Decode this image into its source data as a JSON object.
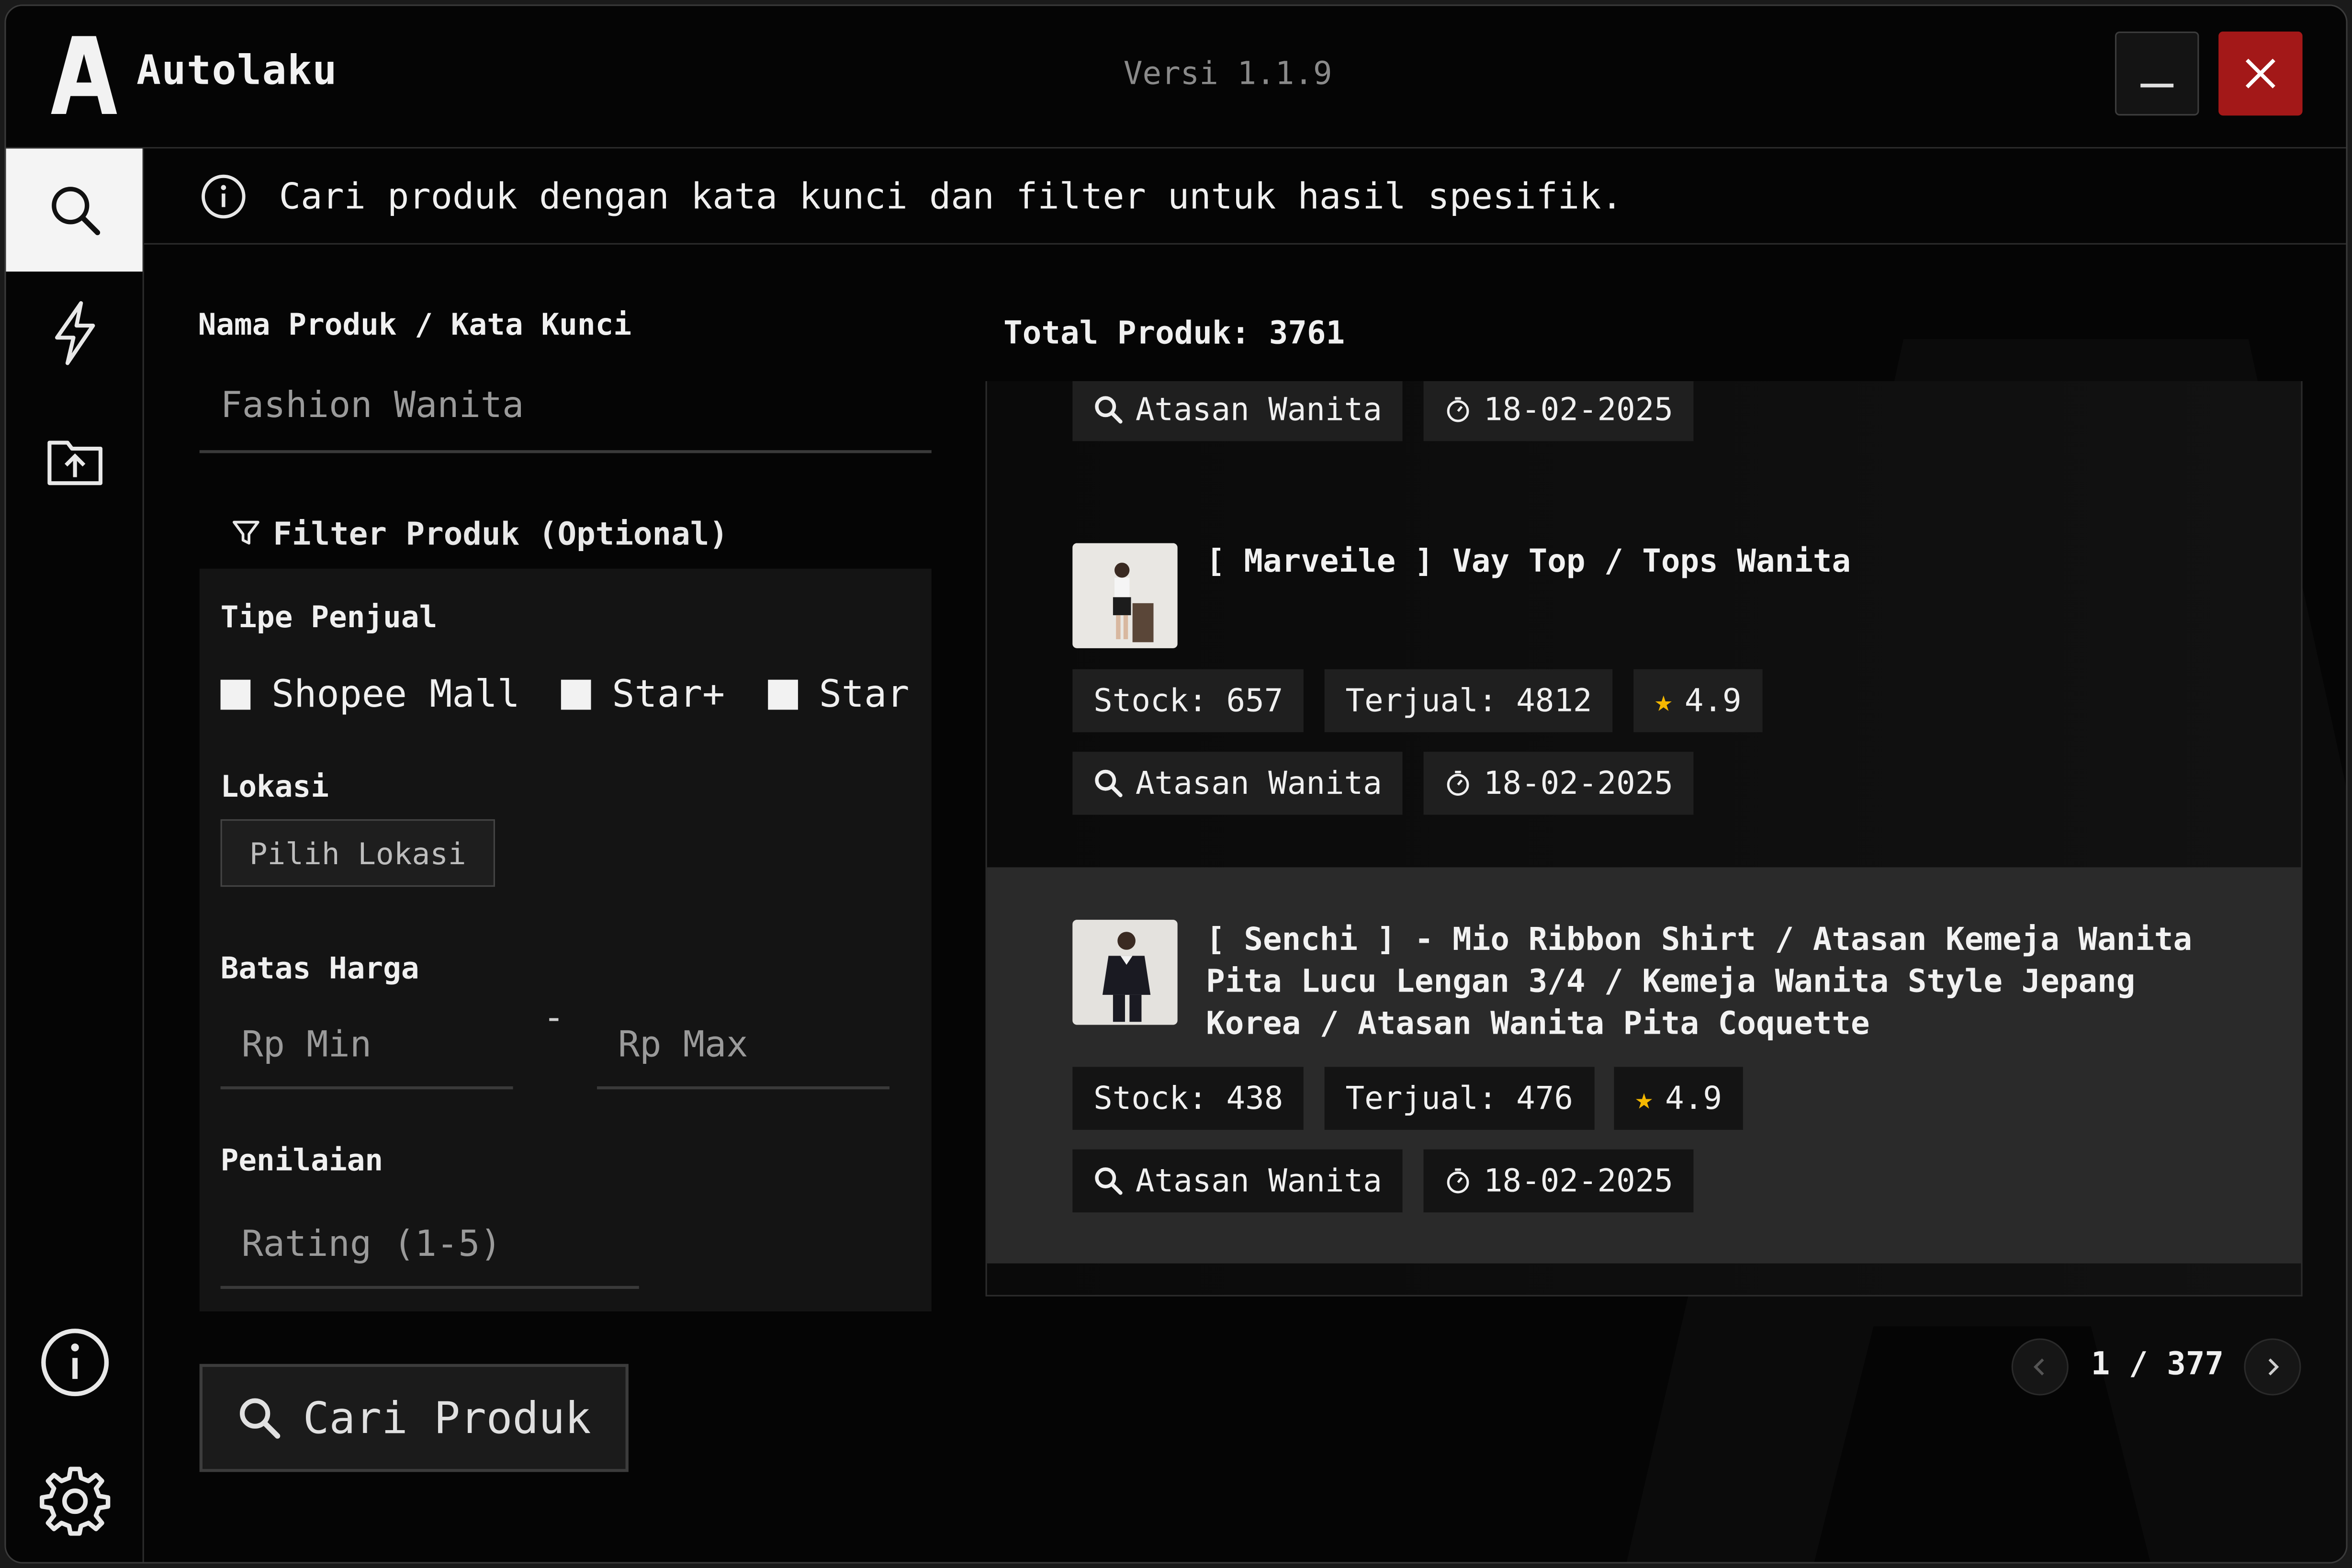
{
  "app": {
    "title": "Autolaku",
    "version": "Versi 1.1.9",
    "accent_close": "#a31818"
  },
  "sidebar": {
    "items": [
      {
        "icon": "search-icon",
        "active": true
      },
      {
        "icon": "lightning-icon",
        "active": false
      },
      {
        "icon": "folder-upload-icon",
        "active": false
      },
      {
        "icon": "info-icon",
        "active": false
      },
      {
        "icon": "gear-icon",
        "active": false
      }
    ]
  },
  "info_bar": {
    "text": "Cari produk dengan kata kunci dan filter untuk hasil spesifik."
  },
  "search": {
    "label": "Nama Produk / Kata Kunci",
    "value": "Fashion Wanita"
  },
  "filter": {
    "heading": "Filter Produk (Optional)",
    "seller_type_label": "Tipe Penjual",
    "seller_types": [
      "Shopee Mall",
      "Star+",
      "Star"
    ],
    "location_label": "Lokasi",
    "location_button": "Pilih Lokasi",
    "price_label": "Batas Harga",
    "price_min_placeholder": "Rp Min",
    "price_separator": "-",
    "price_max_placeholder": "Rp Max",
    "rating_label": "Penilaian",
    "rating_placeholder": "Rating (1-5)"
  },
  "search_button": "Cari Produk",
  "results": {
    "total_label": "Total Produk: 3761",
    "partial_card": {
      "category": "Atasan Wanita",
      "date": "18-02-2025"
    },
    "cards": [
      {
        "title": "[ Marveile ] Vay Top / Tops Wanita",
        "stock": "Stock: 657",
        "sold": "Terjual: 4812",
        "rating": "4.9",
        "category": "Atasan Wanita",
        "date": "18-02-2025"
      },
      {
        "title": "[ Senchi ] - Mio Ribbon Shirt / Atasan Kemeja Wanita Pita Lucu Lengan 3/4 / Kemeja Wanita Style Jepang Korea / Atasan Wanita Pita Coquette",
        "stock": "Stock: 438",
        "sold": "Terjual: 476",
        "rating": "4.9",
        "category": "Atasan Wanita",
        "date": "18-02-2025"
      }
    ]
  },
  "pagination": {
    "text": "1 / 377"
  }
}
